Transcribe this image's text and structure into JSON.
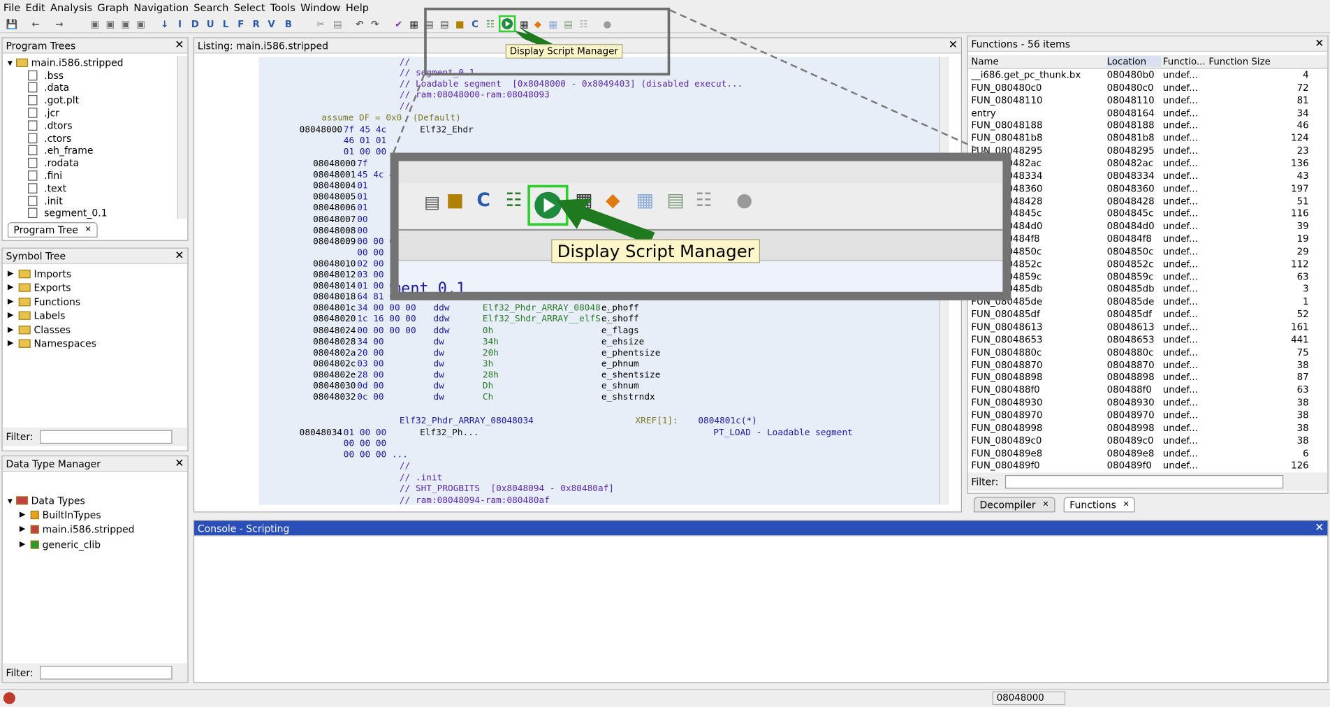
{
  "menu": [
    "File",
    "Edit",
    "Analysis",
    "Graph",
    "Navigation",
    "Search",
    "Select",
    "Tools",
    "Window",
    "Help"
  ],
  "program_trees": {
    "title": "Program Trees",
    "root": "main.i586.stripped",
    "items": [
      ".bss",
      ".data",
      ".got.plt",
      ".jcr",
      ".dtors",
      ".ctors",
      ".eh_frame",
      ".rodata",
      ".fini",
      ".text",
      ".init",
      "segment_0.1"
    ],
    "tab": "Program Tree"
  },
  "symbol_tree": {
    "title": "Symbol Tree",
    "items": [
      "Imports",
      "Exports",
      "Functions",
      "Labels",
      "Classes",
      "Namespaces"
    ],
    "filter_label": "Filter:"
  },
  "data_type_manager": {
    "title": "Data Type Manager",
    "root": "Data Types",
    "items": [
      "BuiltInTypes",
      "main.i586.stripped",
      "generic_clib"
    ],
    "filter_label": "Filter:"
  },
  "listing": {
    "title": "Listing:  main.i586.stripped",
    "top_comments": [
      "//",
      "// segment_0.1",
      "// Loadable segment  [0x8048000 - 0x8049403] (disabled execut...",
      "// ram:08048000-ram:08048093",
      "//"
    ],
    "assume": "assume DF = 0x0  (Default)",
    "header": {
      "addr": "08048000",
      "bytes": "7f 45 4c",
      "label": "Elf32_Ehdr",
      "more1": "46 01 01",
      "more2": "01 00 00 ..."
    },
    "rows": [
      {
        "addr": "08048000",
        "bytes": "7f",
        "op": "",
        "val": "",
        "name": ""
      },
      {
        "addr": "08048001",
        "bytes": "45 4c 4",
        "op": "",
        "val": "",
        "name": ""
      },
      {
        "addr": "08048004",
        "bytes": "01",
        "op": "",
        "val": "",
        "name": ""
      },
      {
        "addr": "08048005",
        "bytes": "01",
        "op": "",
        "val": "",
        "name": ""
      },
      {
        "addr": "08048006",
        "bytes": "01",
        "op": "",
        "val": "",
        "name": ""
      },
      {
        "addr": "08048007",
        "bytes": "00",
        "op": "",
        "val": "",
        "name": ""
      },
      {
        "addr": "08048008",
        "bytes": "00",
        "op": "",
        "val": "",
        "name": ""
      },
      {
        "addr": "08048009",
        "bytes": "00 00 0",
        "op": "",
        "val": "",
        "name": ""
      },
      {
        "addr": "",
        "bytes": "00 00",
        "op": "",
        "val": "",
        "name": ""
      },
      {
        "addr": "08048010",
        "bytes": "02 00",
        "op": "",
        "val": "",
        "name": ""
      },
      {
        "addr": "08048012",
        "bytes": "03 00",
        "op": "",
        "val": "",
        "name": ""
      },
      {
        "addr": "08048014",
        "bytes": "01 00 0",
        "op": "",
        "val": "",
        "name": ""
      },
      {
        "addr": "08048018",
        "bytes": "64 81 0",
        "op": "",
        "val": "",
        "name": ""
      },
      {
        "addr": "0804801c",
        "bytes": "34 00 00 00",
        "op": "ddw",
        "val": "Elf32_Phdr_ARRAY_08048...",
        "name": "e_phoff"
      },
      {
        "addr": "08048020",
        "bytes": "1c 16 00 00",
        "op": "ddw",
        "val": "Elf32_Shdr_ARRAY__elfS...",
        "name": "e_shoff"
      },
      {
        "addr": "08048024",
        "bytes": "00 00 00 00",
        "op": "ddw",
        "val": "0h",
        "name": "e_flags"
      },
      {
        "addr": "08048028",
        "bytes": "34 00",
        "op": "dw",
        "val": "34h",
        "name": "e_ehsize"
      },
      {
        "addr": "0804802a",
        "bytes": "20 00",
        "op": "dw",
        "val": "20h",
        "name": "e_phentsize"
      },
      {
        "addr": "0804802c",
        "bytes": "03 00",
        "op": "dw",
        "val": "3h",
        "name": "e_phnum"
      },
      {
        "addr": "0804802e",
        "bytes": "28 00",
        "op": "dw",
        "val": "28h",
        "name": "e_shentsize"
      },
      {
        "addr": "08048030",
        "bytes": "0d 00",
        "op": "dw",
        "val": "Dh",
        "name": "e_shnum"
      },
      {
        "addr": "08048032",
        "bytes": "0c 00",
        "op": "dw",
        "val": "Ch",
        "name": "e_shstrndx"
      }
    ],
    "phdr_label": "Elf32_Phdr_ARRAY_08048034",
    "xref": "XREF[1]:",
    "xref_addr": "0804801c(*)",
    "phdr_addr": "08048034",
    "phdr_bytes": "01 00 00",
    "phdr_bytes2": "00 00 00",
    "phdr_bytes3": "00 00 00 ...",
    "phdr_type": "Elf32_Ph...",
    "phdr_comment": "PT_LOAD - Loadable segment",
    "bottom_comments": [
      "//",
      "// .init",
      "// SHT_PROGBITS  [0x8048094 - 0x80480af]",
      "// ram:08048094-ram:080480af"
    ]
  },
  "tooltip": "Display Script Manager",
  "zoom_tooltip": "Display Script Manager",
  "zoom_partial_text": "ment 0.1",
  "functions": {
    "title": "Functions - 56 items",
    "columns": [
      "Name",
      "Location",
      "Functio...",
      "Function Size"
    ],
    "rows": [
      [
        "__i686.get_pc_thunk.bx",
        "080480b0",
        "undef...",
        "4"
      ],
      [
        "FUN_080480c0",
        "080480c0",
        "undef...",
        "72"
      ],
      [
        "FUN_08048110",
        "08048110",
        "undef...",
        "81"
      ],
      [
        "entry",
        "08048164",
        "undef...",
        "34"
      ],
      [
        "FUN_08048188",
        "08048188",
        "undef...",
        "46"
      ],
      [
        "FUN_080481b8",
        "080481b8",
        "undef...",
        "124"
      ],
      [
        "FUN_08048295",
        "08048295",
        "undef...",
        "23"
      ],
      [
        "FUN_080482ac",
        "080482ac",
        "undef...",
        "136"
      ],
      [
        "FUN_08048334",
        "08048334",
        "undef...",
        "43"
      ],
      [
        "FUN_08048360",
        "08048360",
        "undef...",
        "197"
      ],
      [
        "FUN_08048428",
        "08048428",
        "undef...",
        "51"
      ],
      [
        "FUN_0804845c",
        "0804845c",
        "undef...",
        "116"
      ],
      [
        "FUN_080484d0",
        "080484d0",
        "undef...",
        "39"
      ],
      [
        "FUN_080484f8",
        "080484f8",
        "undef...",
        "19"
      ],
      [
        "FUN_0804850c",
        "0804850c",
        "undef...",
        "29"
      ],
      [
        "FUN_0804852c",
        "0804852c",
        "undef...",
        "112"
      ],
      [
        "FUN_0804859c",
        "0804859c",
        "undef...",
        "63"
      ],
      [
        "FUN_080485db",
        "080485db",
        "undef...",
        "3"
      ],
      [
        "FUN_080485de",
        "080485de",
        "undef...",
        "1"
      ],
      [
        "FUN_080485df",
        "080485df",
        "undef...",
        "52"
      ],
      [
        "FUN_08048613",
        "08048613",
        "undef...",
        "161"
      ],
      [
        "FUN_08048653",
        "08048653",
        "undef...",
        "441"
      ],
      [
        "FUN_0804880c",
        "0804880c",
        "undef...",
        "75"
      ],
      [
        "FUN_08048870",
        "08048870",
        "undef...",
        "38"
      ],
      [
        "FUN_08048898",
        "08048898",
        "undef...",
        "87"
      ],
      [
        "FUN_080488f0",
        "080488f0",
        "undef...",
        "63"
      ],
      [
        "FUN_08048930",
        "08048930",
        "undef...",
        "38"
      ],
      [
        "FUN_08048970",
        "08048970",
        "undef...",
        "38"
      ],
      [
        "FUN_08048998",
        "08048998",
        "undef...",
        "38"
      ],
      [
        "FUN_080489c0",
        "080489c0",
        "undef...",
        "38"
      ],
      [
        "FUN_080489e8",
        "080489e8",
        "undef...",
        "6"
      ],
      [
        "FUN_080489f0",
        "080489f0",
        "undef...",
        "126"
      ]
    ],
    "filter_label": "Filter:",
    "tabs": [
      "Decompiler",
      "Functions"
    ]
  },
  "console": {
    "title": "Console - Scripting"
  },
  "status": {
    "address": "08048000"
  },
  "colors": {
    "accent_green": "#1aa11a",
    "arrow_green": "#1f7a1f",
    "selection_blue": "#e8eef8",
    "tooltip_bg": "#fdf6c8"
  }
}
